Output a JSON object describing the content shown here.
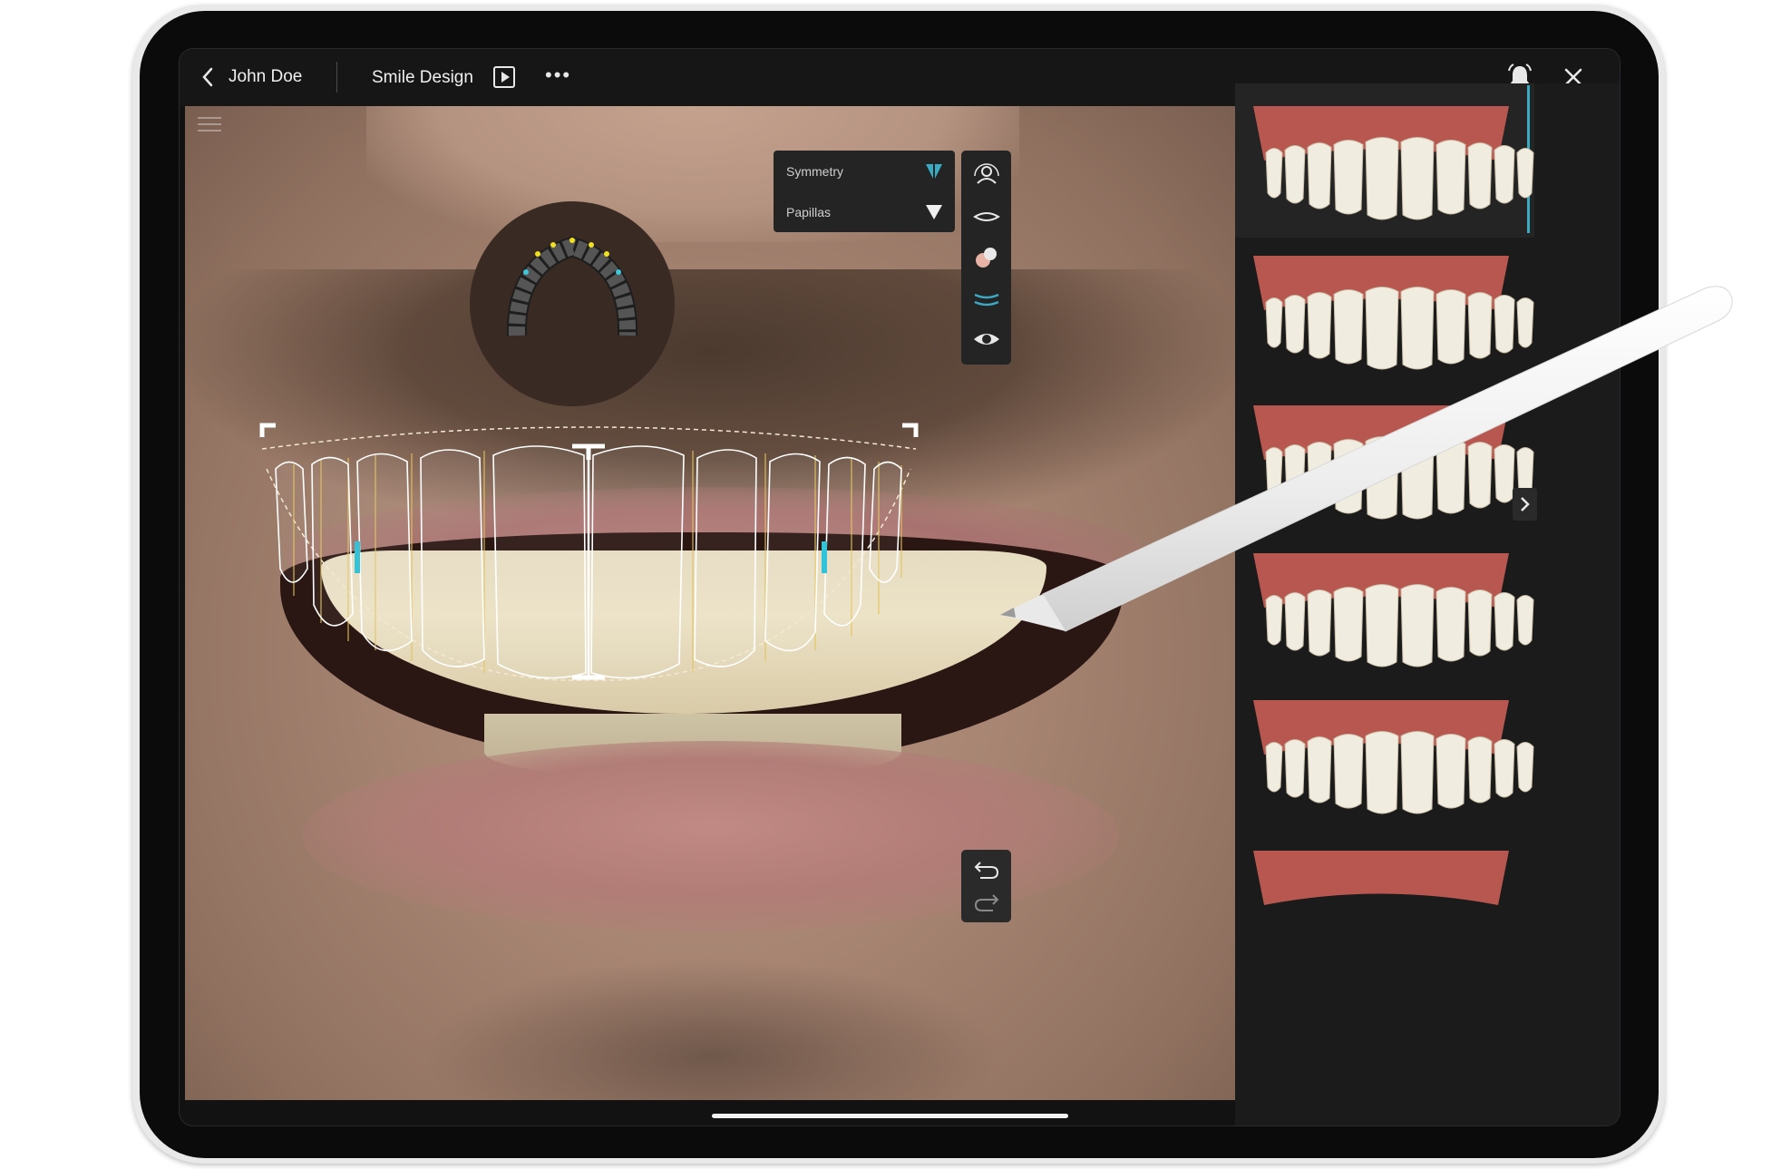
{
  "header": {
    "back_label": "John Doe",
    "title": "Smile Design"
  },
  "symmetry_panel": {
    "rows": [
      {
        "label": "Symmetry",
        "active": true
      },
      {
        "label": "Papillas",
        "active": false
      }
    ]
  },
  "tools": [
    "face-reference-icon",
    "lip-line-icon",
    "color-shade-icon",
    "smile-curve-icon",
    "visibility-icon"
  ],
  "history": [
    "undo-icon",
    "redo-icon"
  ],
  "gallery": {
    "selected_index": 0,
    "templates_visible": 6
  },
  "colors": {
    "accent": "#3aa9c4",
    "panel": "#242425",
    "topbar": "#161617"
  }
}
